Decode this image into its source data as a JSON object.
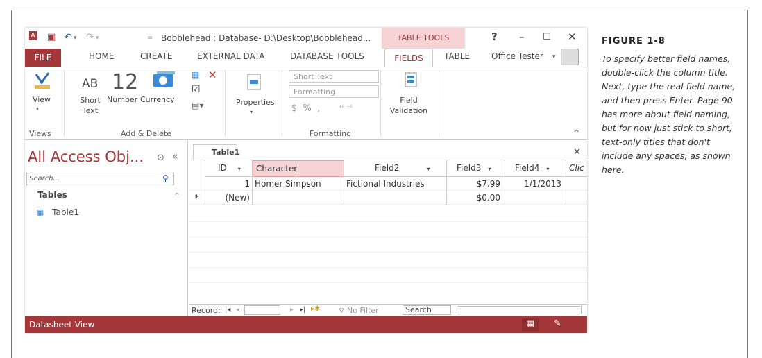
{
  "figure": {
    "label": "FIGURE 1-8",
    "caption": "To specify better field names, double-click the column title. Next, type the real field name, and then press Enter. Page 90 has more about field naming, but for now just stick to short, text-only titles that don't include any spaces, as shown here."
  },
  "window": {
    "title": "Bobblehead : Database- D:\\Desktop\\Bobblehead...",
    "table_tools": "TABLE TOOLS",
    "help": "?",
    "user": "Office Tester"
  },
  "tabs": [
    "FILE",
    "HOME",
    "CREATE",
    "EXTERNAL DATA",
    "DATABASE TOOLS",
    "FIELDS",
    "TABLE"
  ],
  "ribbon": {
    "view_label": "View",
    "ab_glyph": "AB",
    "twelve_glyph": "12",
    "short_text_label": "Short\nText",
    "number_label": "Number",
    "currency_label": "Currency",
    "properties_label": "Properties",
    "data_type_value": "Short Text",
    "format_value": "Formatting",
    "format_symbols": "$  %  ,",
    "field_validation_label": "Field\nValidation",
    "groups": {
      "views": "Views",
      "add_delete": "Add & Delete",
      "formatting": "Formatting"
    }
  },
  "nav": {
    "title": "All Access Obj...",
    "search_placeholder": "Search...",
    "section": "Tables",
    "items": [
      "Table1"
    ]
  },
  "table": {
    "tab": "Table1",
    "columns": [
      "ID",
      "Character",
      "Field2",
      "Field3",
      "Field4",
      "Clic"
    ],
    "rows": [
      [
        "1",
        "Homer Simpson",
        "Fictional Industries",
        "$7.99",
        "1/1/2013",
        ""
      ],
      [
        "(New)",
        "",
        "",
        "$0.00",
        "",
        ""
      ]
    ],
    "new_row_marker": "*"
  },
  "record_nav": {
    "label": "Record:",
    "filter": "No Filter",
    "search": "Search"
  },
  "status": {
    "text": "Datasheet View"
  },
  "colors": {
    "accent": "#a4373a"
  }
}
